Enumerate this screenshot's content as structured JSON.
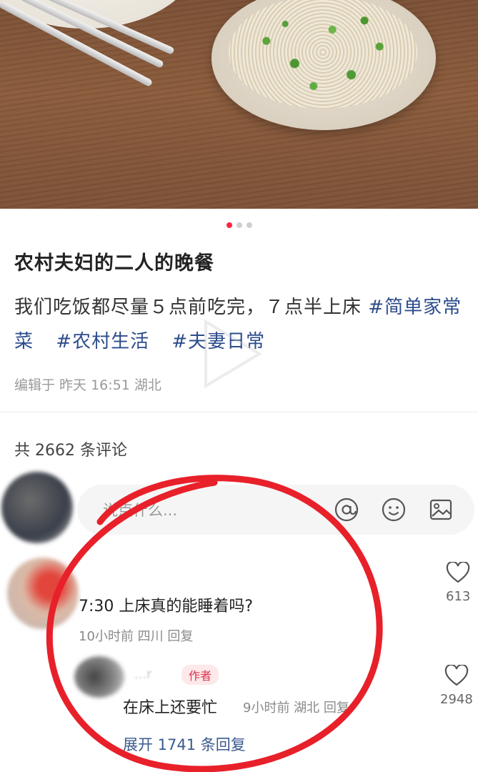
{
  "post": {
    "title": "农村夫妇的二人的晚餐",
    "description_text": "我们吃饭都尽量５点前吃完，７点半上床",
    "tags": [
      "#简单家常菜",
      "#农村生活",
      "#夫妻日常"
    ],
    "edit_meta": "编辑于 昨天 16:51 湖北",
    "carousel": {
      "total": 3,
      "active": 1
    }
  },
  "comments_section": {
    "count_label": "共 2662 条评论",
    "input_placeholder": "说点什么...",
    "icons": [
      "at-icon",
      "emoji-icon",
      "image-icon"
    ]
  },
  "comment": {
    "text": "7:30 上床真的能睡着吗?",
    "meta": "10小时前 四川 回复",
    "likes": "613"
  },
  "reply": {
    "name": "...r",
    "badge": "作者",
    "text": "在床上还要忙",
    "meta": "9小时前 湖北 回复",
    "likes": "2948",
    "expand_label": "展开 1741 条回复"
  },
  "colors": {
    "accent": "#ff2442",
    "tag": "#2d4c8c",
    "annotation_circle": "#e8202a"
  }
}
